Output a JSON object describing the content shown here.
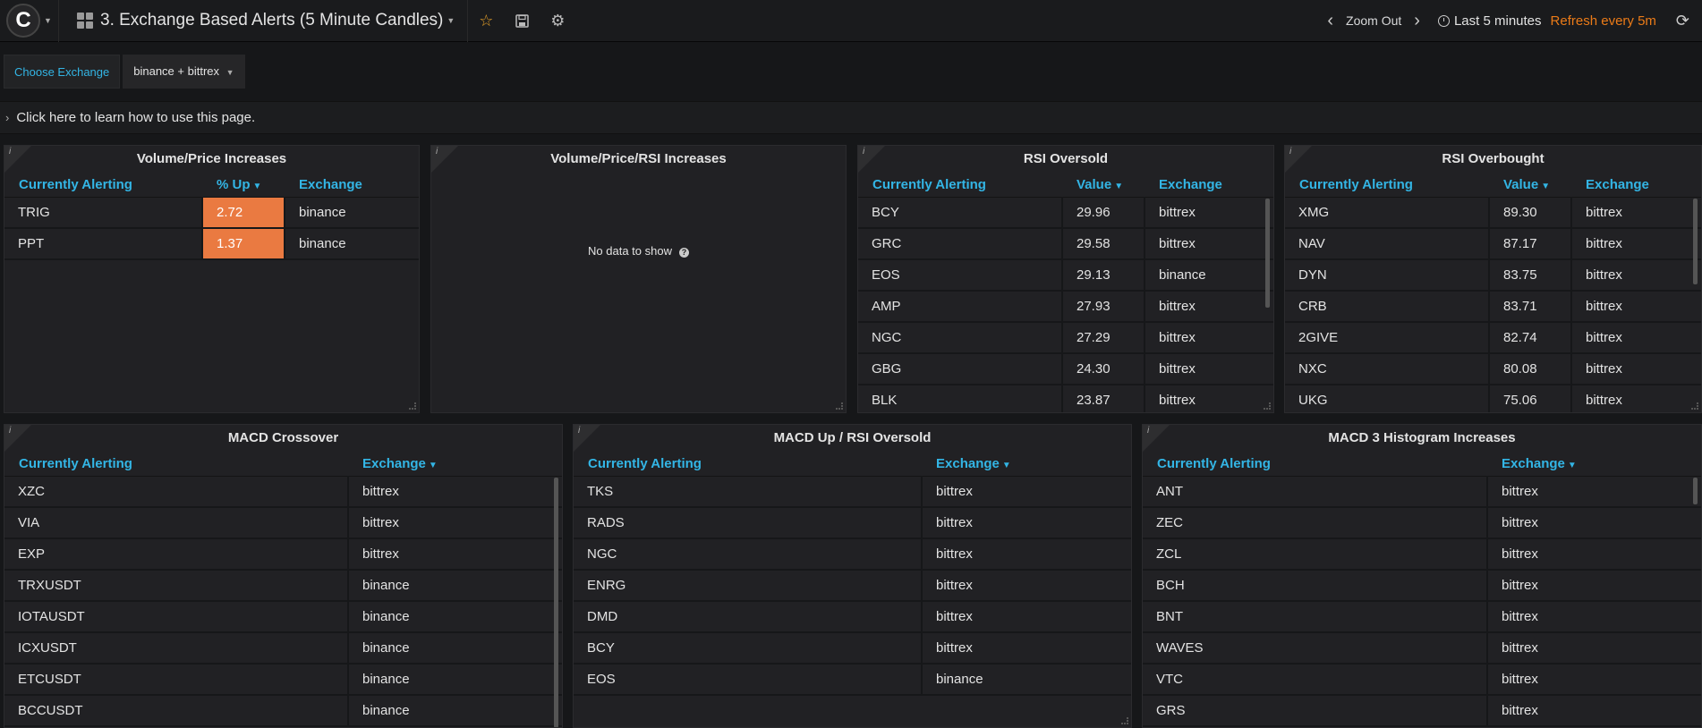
{
  "nav": {
    "logo_glyph": "C",
    "dashboard_title": "3. Exchange Based Alerts (5 Minute Candles)",
    "zoom_out": "Zoom Out",
    "time_range": "Last 5 minutes",
    "refresh": "Refresh every 5m",
    "accent_refresh": "#eb7b18",
    "star_color": "#e5a029"
  },
  "variables": {
    "label": "Choose Exchange",
    "value": "binance + bittrex"
  },
  "row": {
    "title": "Click here to learn how to use this page."
  },
  "panels": {
    "vol_price": {
      "title": "Volume/Price Increases",
      "columns": [
        "Currently Alerting",
        "% Up",
        "Exchange"
      ],
      "rows": [
        [
          "TRIG",
          "2.72",
          "binance"
        ],
        [
          "PPT",
          "1.37",
          "binance"
        ]
      ]
    },
    "vol_price_rsi": {
      "title": "Volume/Price/RSI Increases",
      "nodata": "No data to show"
    },
    "rsi_oversold": {
      "title": "RSI Oversold",
      "columns": [
        "Currently Alerting",
        "Value",
        "Exchange"
      ],
      "rows": [
        [
          "BCY",
          "29.96",
          "bittrex"
        ],
        [
          "GRC",
          "29.58",
          "bittrex"
        ],
        [
          "EOS",
          "29.13",
          "binance"
        ],
        [
          "AMP",
          "27.93",
          "bittrex"
        ],
        [
          "NGC",
          "27.29",
          "bittrex"
        ],
        [
          "GBG",
          "24.30",
          "bittrex"
        ],
        [
          "BLK",
          "23.87",
          "bittrex"
        ]
      ]
    },
    "rsi_overbought": {
      "title": "RSI Overbought",
      "columns": [
        "Currently Alerting",
        "Value",
        "Exchange"
      ],
      "rows": [
        [
          "XMG",
          "89.30",
          "bittrex"
        ],
        [
          "NAV",
          "87.17",
          "bittrex"
        ],
        [
          "DYN",
          "83.75",
          "bittrex"
        ],
        [
          "CRB",
          "83.71",
          "bittrex"
        ],
        [
          "2GIVE",
          "82.74",
          "bittrex"
        ],
        [
          "NXC",
          "80.08",
          "bittrex"
        ],
        [
          "UKG",
          "75.06",
          "bittrex"
        ]
      ]
    },
    "macd_crossover": {
      "title": "MACD Crossover",
      "columns": [
        "Currently Alerting",
        "Exchange"
      ],
      "rows": [
        [
          "XZC",
          "bittrex"
        ],
        [
          "VIA",
          "bittrex"
        ],
        [
          "EXP",
          "bittrex"
        ],
        [
          "TRXUSDT",
          "binance"
        ],
        [
          "IOTAUSDT",
          "binance"
        ],
        [
          "ICXUSDT",
          "binance"
        ],
        [
          "ETCUSDT",
          "binance"
        ],
        [
          "BCCUSDT",
          "binance"
        ]
      ]
    },
    "macd_up_rsi": {
      "title": "MACD Up / RSI Oversold",
      "columns": [
        "Currently Alerting",
        "Exchange"
      ],
      "rows": [
        [
          "TKS",
          "bittrex"
        ],
        [
          "RADS",
          "bittrex"
        ],
        [
          "NGC",
          "bittrex"
        ],
        [
          "ENRG",
          "bittrex"
        ],
        [
          "DMD",
          "bittrex"
        ],
        [
          "BCY",
          "bittrex"
        ],
        [
          "EOS",
          "binance"
        ]
      ]
    },
    "macd_hist": {
      "title": "MACD 3 Histogram Increases",
      "columns": [
        "Currently Alerting",
        "Exchange"
      ],
      "rows": [
        [
          "ANT",
          "bittrex"
        ],
        [
          "ZEC",
          "bittrex"
        ],
        [
          "ZCL",
          "bittrex"
        ],
        [
          "BCH",
          "bittrex"
        ],
        [
          "BNT",
          "bittrex"
        ],
        [
          "WAVES",
          "bittrex"
        ],
        [
          "VTC",
          "bittrex"
        ],
        [
          "GRS",
          "bittrex"
        ]
      ]
    }
  }
}
